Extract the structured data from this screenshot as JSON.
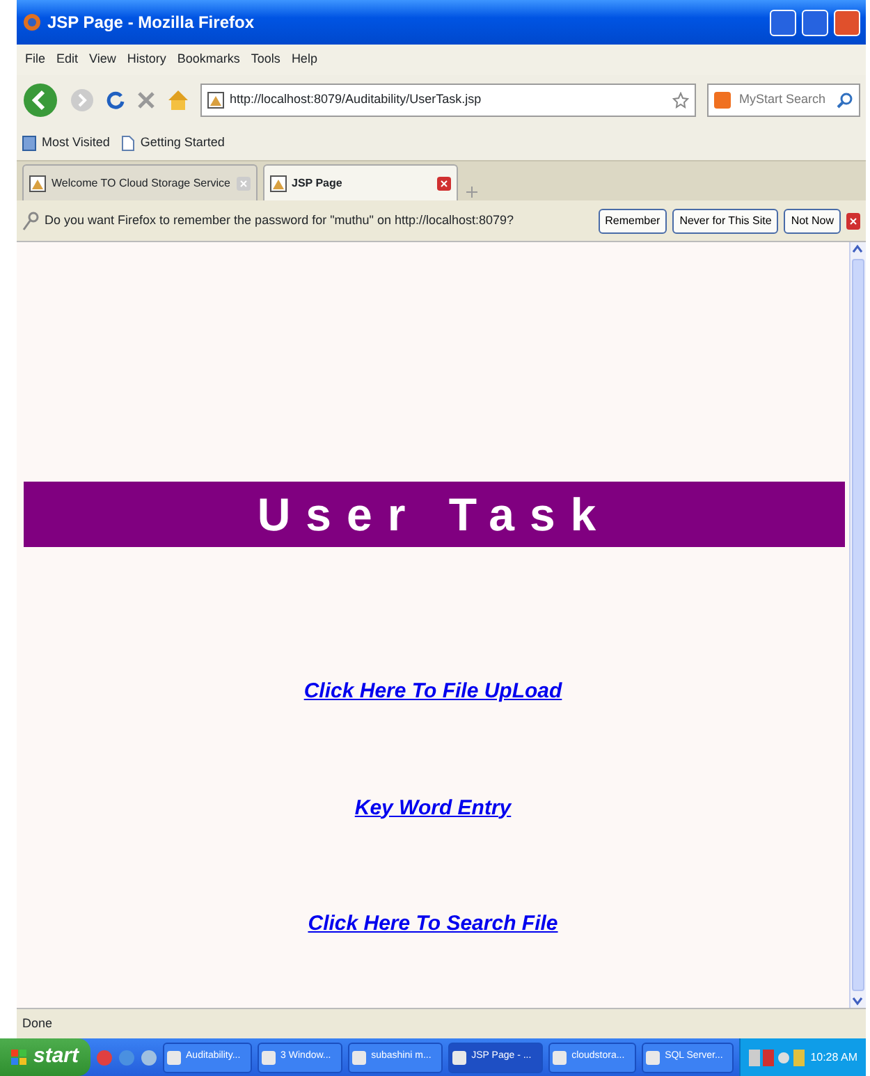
{
  "window": {
    "title": "JSP Page - Mozilla Firefox"
  },
  "menu": [
    "File",
    "Edit",
    "View",
    "History",
    "Bookmarks",
    "Tools",
    "Help"
  ],
  "address": {
    "url": "http://localhost:8079/Auditability/UserTask.jsp"
  },
  "search": {
    "placeholder": "MyStart Search"
  },
  "bookmarks": [
    "Most Visited",
    "Getting Started"
  ],
  "tabs": [
    {
      "label": "Welcome TO Cloud Storage Service",
      "selected": false
    },
    {
      "label": "JSP Page",
      "selected": true
    }
  ],
  "notification": {
    "text": "Do you want Firefox to remember the password for \"muthu\" on http://localhost:8079?",
    "buttons": [
      "Remember",
      "Never for This Site",
      "Not Now"
    ]
  },
  "page": {
    "heading": "User Task",
    "links": [
      "Click Here To File UpLoad",
      "Key Word Entry",
      "Click Here To Search File"
    ]
  },
  "status_bar": "Done",
  "taskbar": {
    "start": "start",
    "tasks": [
      {
        "label": "Auditability...",
        "selected": false
      },
      {
        "label": "3 Window...",
        "selected": false
      },
      {
        "label": "subashini m...",
        "selected": false
      },
      {
        "label": "JSP Page - ...",
        "selected": true
      },
      {
        "label": "cloudstora...",
        "selected": false
      },
      {
        "label": "SQL Server...",
        "selected": false
      }
    ],
    "clock": "10:28 AM"
  }
}
